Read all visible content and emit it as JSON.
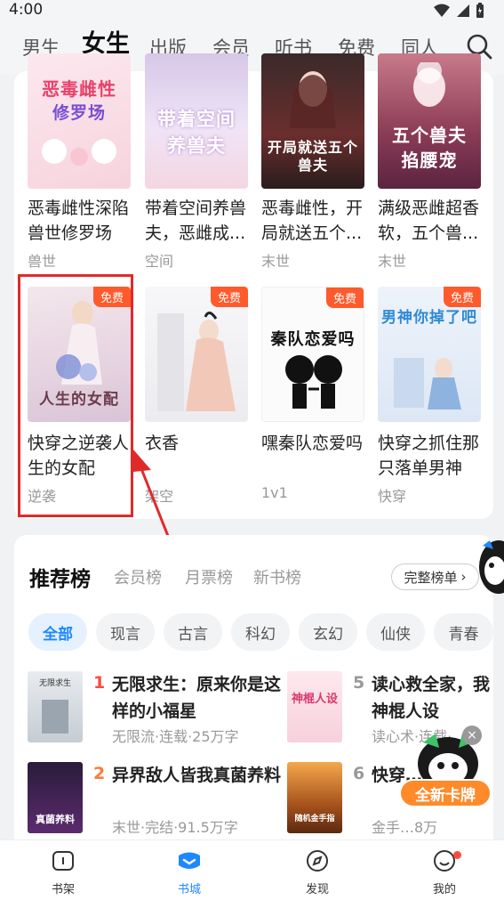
{
  "status": {
    "time": "4:00"
  },
  "nav": {
    "tabs": [
      "男生",
      "女生",
      "出版",
      "会员",
      "听书",
      "免费",
      "同人"
    ],
    "active": "女生"
  },
  "row1": [
    {
      "title": "恶毒雌性深陷兽世修罗场",
      "tag": "兽世",
      "cover_text": "恶毒雌性",
      "cover_sub": "修罗场"
    },
    {
      "title": "带着空间养兽夫，恶雌成...",
      "tag": "空间",
      "cover_text": "带着空间",
      "cover_sub": "养兽夫"
    },
    {
      "title": "恶毒雌性，开局就送五个...",
      "tag": "末世",
      "cover_text": "恶毒雌性",
      "cover_sub": "开局就送五个兽夫"
    },
    {
      "title": "满级恶雌超香软，五个兽...",
      "tag": "末世",
      "cover_text": "五个兽夫",
      "cover_sub": "掐腰宠"
    }
  ],
  "row2": [
    {
      "title": "快穿之逆袭人生的女配",
      "tag": "逆袭",
      "cover_text": "人生的女配",
      "free": "免费"
    },
    {
      "title": "衣香",
      "tag": "架空",
      "cover_text": "",
      "free": "免费"
    },
    {
      "title": "嘿秦队恋爱吗",
      "tag": "1v1",
      "cover_text": "秦队恋爱吗",
      "free": "免费"
    },
    {
      "title": "快穿之抓住那只落单男神",
      "tag": "快穿",
      "cover_text": "男神你掉了吧",
      "free": "免费"
    }
  ],
  "ranking": {
    "heading": "推荐榜",
    "tabs": [
      "会员榜",
      "月票榜",
      "新书榜"
    ],
    "full_list": "完整榜单",
    "chips": [
      "全部",
      "现言",
      "古言",
      "科幻",
      "玄幻",
      "仙侠",
      "青春"
    ],
    "items": [
      {
        "num": "1",
        "title": "无限求生：原来你是这样的小福星",
        "meta": "无限流·连载·25万字",
        "cover_text": "无限求生"
      },
      {
        "num": "2",
        "title": "异界敌人皆我真菌养料",
        "meta": "末世·完结·91.5万字",
        "cover_text": "真菌养料"
      },
      {
        "num": "5",
        "title": "读心救全家，我神棍人设",
        "meta": "读心术·连载·",
        "cover_text": "神棍人设"
      },
      {
        "num": "6",
        "title": "快穿…金手",
        "meta": "金手…8万",
        "cover_text": "随机金手指"
      }
    ]
  },
  "promo": {
    "label": "全新卡牌"
  },
  "bottom_nav": [
    "书架",
    "书城",
    "发现",
    "我的"
  ],
  "colors": {
    "accent": "#1e88ff",
    "free": "#ff5a2c",
    "highlight": "#e02a2a"
  }
}
